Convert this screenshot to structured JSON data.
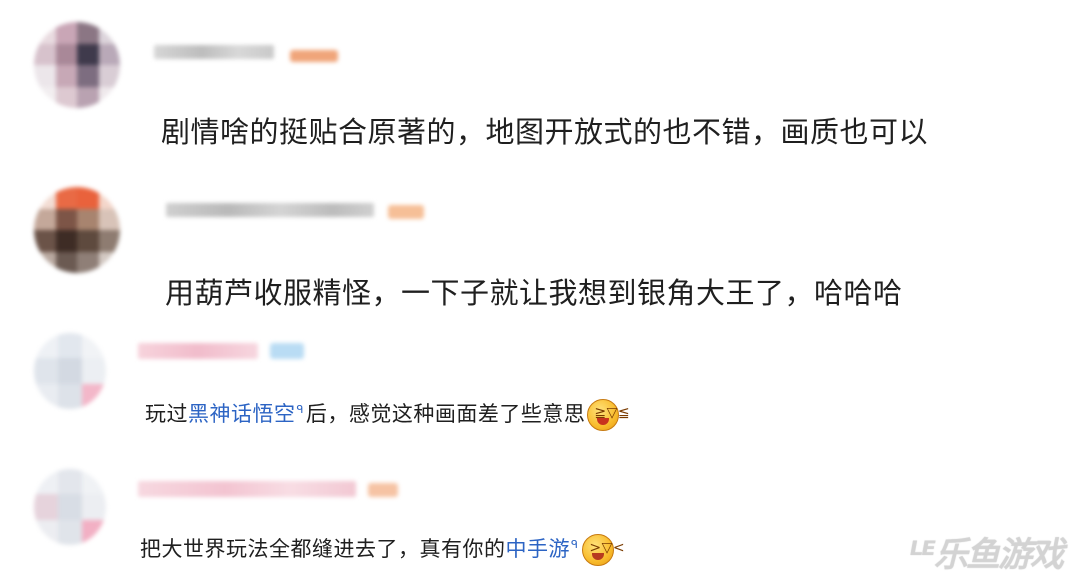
{
  "comments": [
    {
      "text": "剧情啥的挺贴合原著的，地图开放式的也不错，画质也可以"
    },
    {
      "text": "用葫芦收服精怪，一下子就让我想到银角大王了，哈哈哈"
    },
    {
      "before": "玩过",
      "link": "黑神话悟空",
      "link_mark": "ᑫ",
      "after": "后，感觉这种画面差了些意思",
      "emoji": "laughing-face-icon"
    },
    {
      "before": "把大世界玩法全都缝进去了，真有你的",
      "link": "中手游",
      "link_mark": "ᑫ",
      "emoji": "laughing-crying-face-icon"
    }
  ],
  "watermark": "ᴸᴱ乐鱼游戏"
}
